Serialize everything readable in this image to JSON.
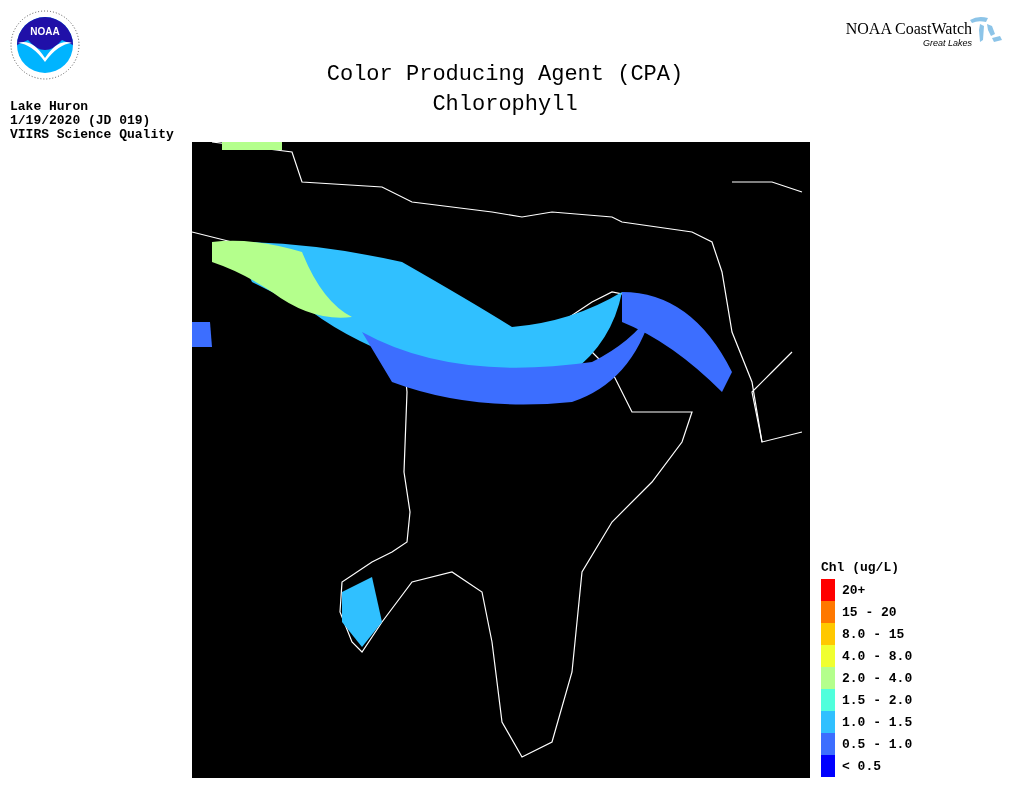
{
  "logo": {
    "text": "NOAA"
  },
  "brand": {
    "name": "NOAA CoastWatch",
    "subtitle": "Great Lakes"
  },
  "title": [
    "Color Producing Agent (CPA)",
    "Chlorophyll"
  ],
  "info": [
    "Lake Huron",
    "1/19/2020 (JD 019)",
    "VIIRS Science Quality"
  ],
  "legend": {
    "title": "Chl (ug/L)",
    "items": [
      {
        "label": "20+",
        "color": "#ff0000"
      },
      {
        "label": "15 - 20",
        "color": "#ff7800"
      },
      {
        "label": "8.0 - 15",
        "color": "#ffc800"
      },
      {
        "label": "4.0 - 8.0",
        "color": "#f0ff30"
      },
      {
        "label": "2.0 - 4.0",
        "color": "#b4ff8c"
      },
      {
        "label": "1.5 - 2.0",
        "color": "#50ffdc"
      },
      {
        "label": "1.0 - 1.5",
        "color": "#30c0ff"
      },
      {
        "label": "0.5 - 1.0",
        "color": "#3c6eff"
      },
      {
        "label": "< 0.5",
        "color": "#0000ff"
      }
    ]
  }
}
